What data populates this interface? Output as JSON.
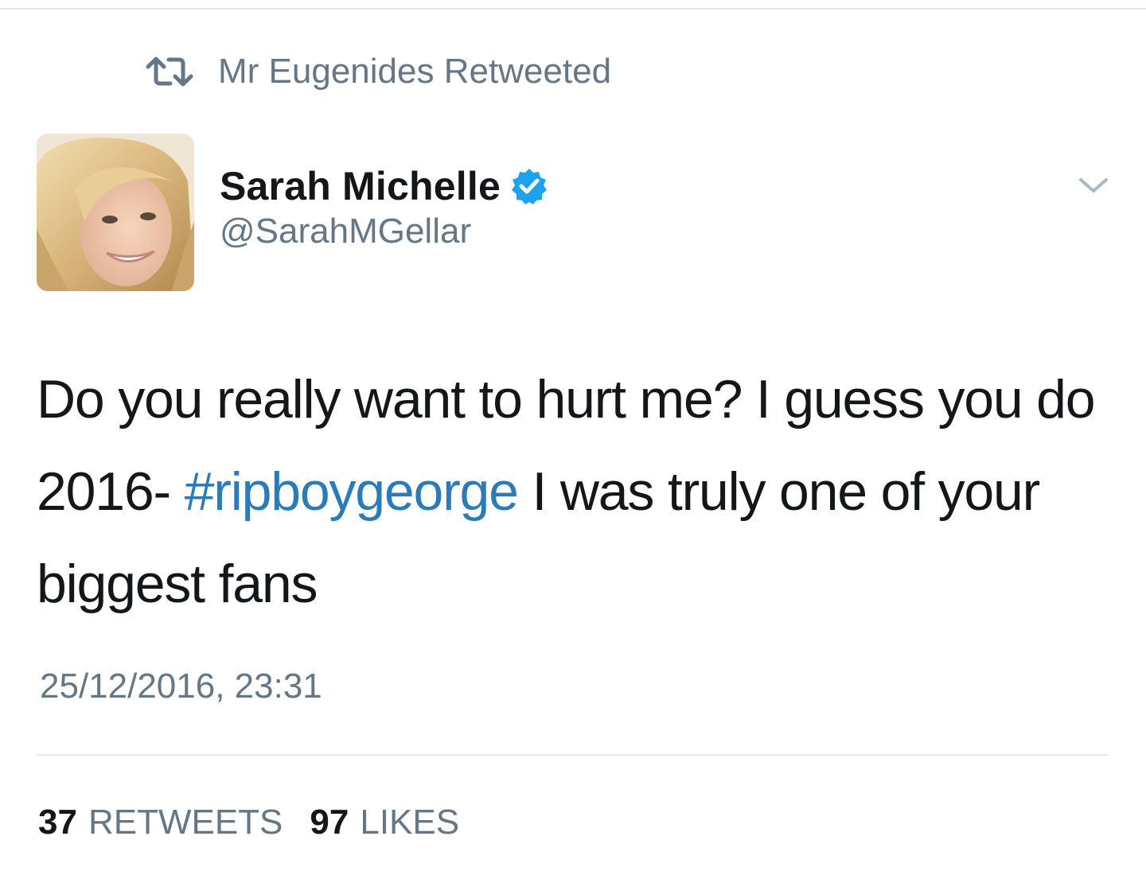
{
  "retweet_context": {
    "icon": "retweet-icon",
    "text": "Mr Eugenides Retweeted"
  },
  "author": {
    "display_name": "Sarah Michelle",
    "handle": "@SarahMGellar",
    "verified": true,
    "avatar": "profile-photo"
  },
  "tweet": {
    "text_before": "Do you really want to hurt me? I guess you do 2016- ",
    "hashtag": "#ripboygeorge",
    "text_after": " I was truly one of your biggest fans",
    "timestamp": "25/12/2016, 23:31"
  },
  "stats": {
    "retweets_count": "37",
    "retweets_label": "RETWEETS",
    "likes_count": "97",
    "likes_label": "LIKES"
  },
  "colors": {
    "text": "#14171a",
    "secondary": "#657786",
    "link": "#2b7bb9",
    "verified": "#1da1f2",
    "divider": "#e1e8ed"
  }
}
